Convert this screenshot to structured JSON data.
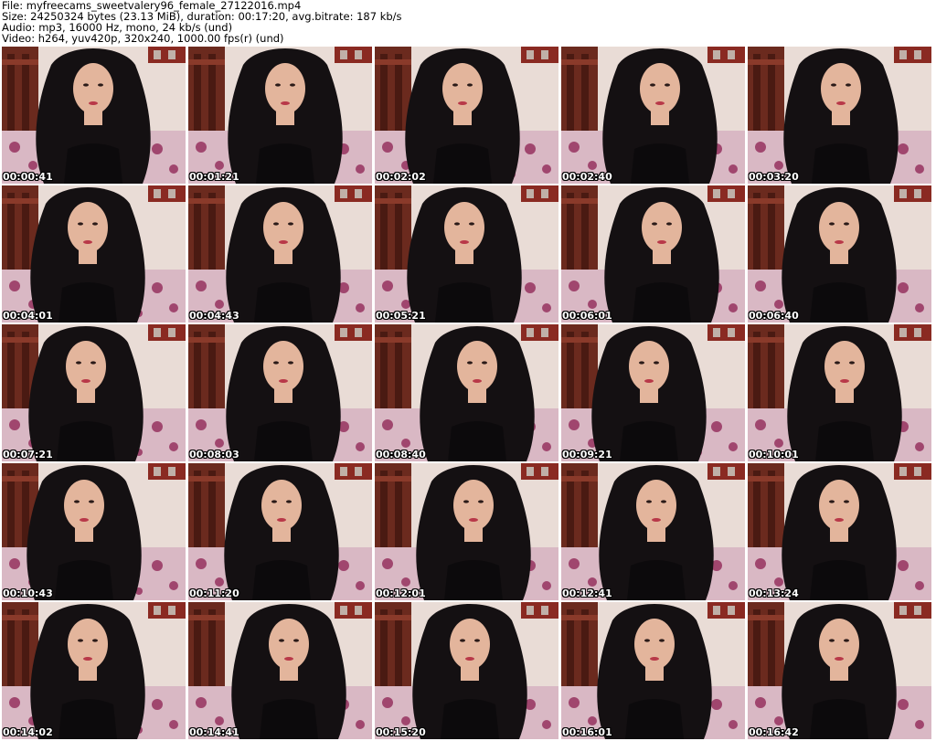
{
  "header": {
    "file_line": "File: myfreecams_sweetvalery96_female_27122016.mp4",
    "size_line": "Size: 24250324 bytes (23.13 MiB), duration: 00:17:20, avg.bitrate: 187 kb/s",
    "audio_line": "Audio: mp3, 16000 Hz, mono, 24 kb/s (und)",
    "video_line": "Video: h264, yuv420p, 320x240, 1000.00 fps(r) (und)"
  },
  "thumbnails": [
    {
      "timestamp": "00:00:41"
    },
    {
      "timestamp": "00:01:21"
    },
    {
      "timestamp": "00:02:02"
    },
    {
      "timestamp": "00:02:40"
    },
    {
      "timestamp": "00:03:20"
    },
    {
      "timestamp": "00:04:01"
    },
    {
      "timestamp": "00:04:43"
    },
    {
      "timestamp": "00:05:21"
    },
    {
      "timestamp": "00:06:01"
    },
    {
      "timestamp": "00:06:40"
    },
    {
      "timestamp": "00:07:21"
    },
    {
      "timestamp": "00:08:03"
    },
    {
      "timestamp": "00:08:40"
    },
    {
      "timestamp": "00:09:21"
    },
    {
      "timestamp": "00:10:01"
    },
    {
      "timestamp": "00:10:43"
    },
    {
      "timestamp": "00:11:20"
    },
    {
      "timestamp": "00:12:01"
    },
    {
      "timestamp": "00:12:41"
    },
    {
      "timestamp": "00:13:24"
    },
    {
      "timestamp": "00:14:02"
    },
    {
      "timestamp": "00:14:41"
    },
    {
      "timestamp": "00:15:20"
    },
    {
      "timestamp": "00:16:01"
    },
    {
      "timestamp": "00:16:42"
    }
  ],
  "colors": {
    "wall": "#e9dcd6",
    "wood": "#6b2a1e",
    "bedding": "#d9b8c4",
    "flower": "#a0466e",
    "hair": "#141012",
    "skin": "#e3b59c",
    "top": "#0c0a0c",
    "lips": "#b83848"
  }
}
